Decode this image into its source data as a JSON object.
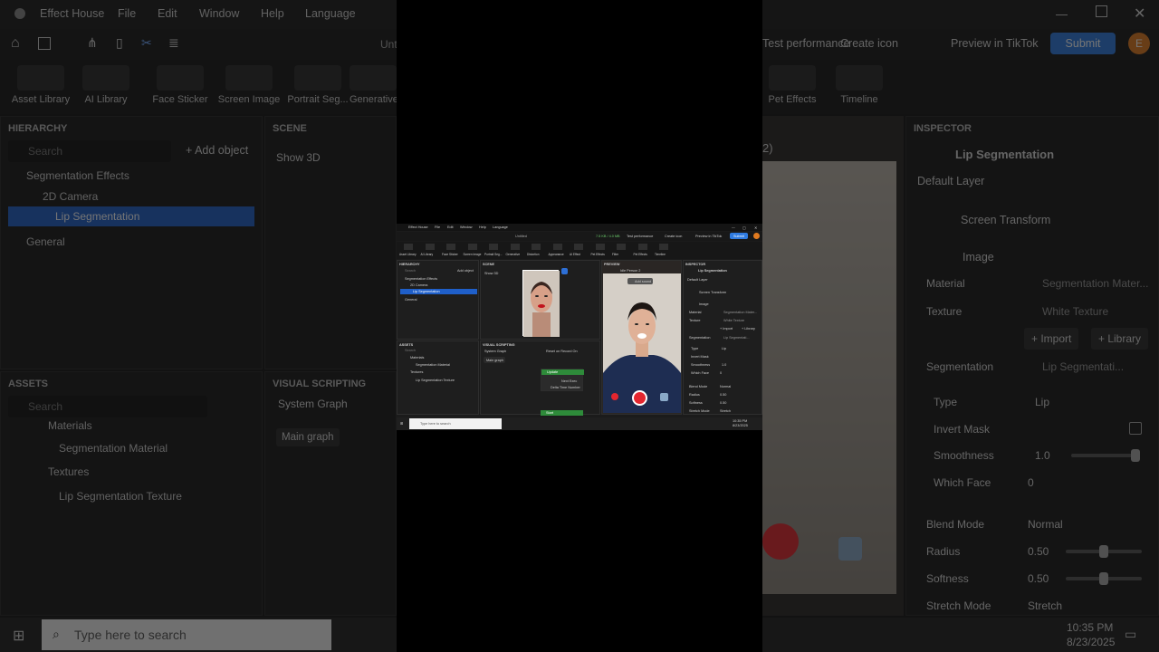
{
  "app": {
    "name": "Effect House",
    "menu": [
      "File",
      "Edit",
      "Window",
      "Help",
      "Language"
    ],
    "project_title": "Untitled",
    "window_controls": [
      "minimize",
      "maximize",
      "close"
    ]
  },
  "toolbar": {
    "status": "7.5 KB / 4.0 MB",
    "test_performance": "Test performance",
    "create_icon": "Create icon",
    "preview_in_tiktok": "Preview in TikTok",
    "submit": "Submit",
    "avatar_letter": "E"
  },
  "asset_tiles": [
    "Asset Library",
    "AI Library",
    "Face Sticker",
    "Screen Image",
    "Portrait Seg...",
    "Generative",
    "Distortion",
    "Appearance",
    "AI Effect",
    "Pet Effects",
    "Filter",
    "Pet Effects",
    "Timeline"
  ],
  "hierarchy": {
    "title": "HIERARCHY",
    "search_placeholder": "Search",
    "add_object": "Add object",
    "items": [
      {
        "label": "Segmentation Effects",
        "level": 0
      },
      {
        "label": "2D Camera",
        "level": 1
      },
      {
        "label": "Lip Segmentation",
        "level": 2,
        "selected": true
      },
      {
        "label": "General",
        "level": 0
      }
    ]
  },
  "scene": {
    "title": "SCENE",
    "view_mode": "Show 3D",
    "zoom": "50%"
  },
  "preview": {
    "title": "PREVIEW",
    "person_select": "Idle Person 2",
    "add_sound": "Add sound",
    "upload": "Upload",
    "effect": "Effects"
  },
  "assets": {
    "title": "ASSETS",
    "search_placeholder": "Search",
    "folders": [
      {
        "label": "Materials",
        "children": [
          "Segmentation Material"
        ]
      },
      {
        "label": "Textures",
        "children": [
          "Lip Segmentation Texture"
        ]
      }
    ]
  },
  "visual_scripting": {
    "title": "VISUAL SCRIPTING",
    "graph_select": "System Graph",
    "graph_mode": "Reset on Record On",
    "main_graph": "Main graph",
    "nodes": [
      {
        "title": "Update",
        "ports": [
          "Next Exec",
          "Delta Time Number"
        ]
      },
      {
        "title": "Start",
        "ports": []
      }
    ]
  },
  "inspector": {
    "title": "INSPECTOR",
    "object_name": "Lip Segmentation",
    "layer": "Default Layer",
    "screen_transform": "Screen Transform",
    "image_section": "Image",
    "material_label": "Material",
    "material_value": "Segmentation Mater...",
    "texture_label": "Texture",
    "texture_value": "White Texture",
    "import": "+ Import",
    "library": "+ Library",
    "segmentation_label": "Segmentation",
    "segmentation_value": "Lip Segmentati...",
    "type_label": "Type",
    "type_value": "Lip",
    "invert_mask_label": "Invert Mask",
    "smoothness_label": "Smoothness",
    "smoothness_value": "1.0",
    "smoothness_fraction": 1.0,
    "which_face_label": "Which Face",
    "which_face_value": "0",
    "blend_mode_label": "Blend Mode",
    "blend_mode_value": "Normal",
    "radius_label": "Radius",
    "radius_value": "0.50",
    "radius_fraction": 0.5,
    "softness_label": "Softness",
    "softness_value": "0.50",
    "softness_fraction": 0.5,
    "stretch_mode_label": "Stretch Mode",
    "stretch_mode_value": "Stretch"
  },
  "taskbar": {
    "search_placeholder": "Type here to search",
    "time": "10:35 PM",
    "date": "8/23/2025"
  },
  "colors": {
    "accent": "#2d6fd6",
    "selected_row": "#1f5fc9",
    "submit": "#2f7be0",
    "record": "#e3262f",
    "avatar": "#e07a1f"
  }
}
